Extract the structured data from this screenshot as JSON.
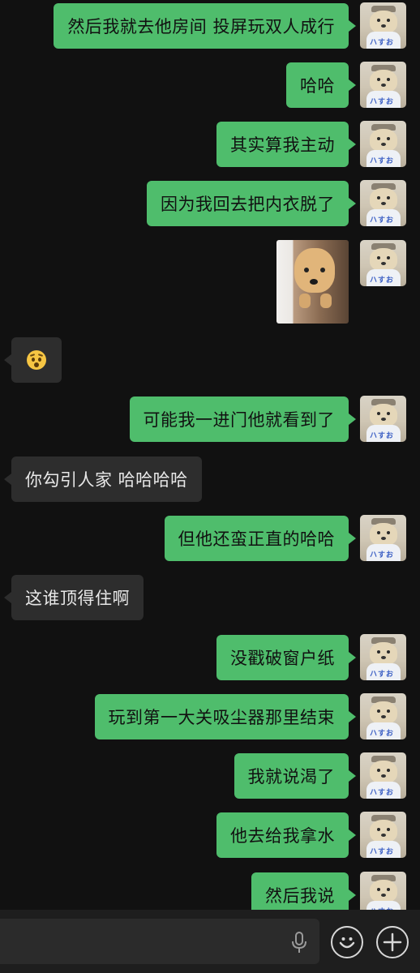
{
  "messages": [
    {
      "dir": "out",
      "type": "text",
      "text": "然后我就去他房间 投屏玩双人成行"
    },
    {
      "dir": "out",
      "type": "text",
      "text": "哈哈"
    },
    {
      "dir": "out",
      "type": "text",
      "text": "其实算我主动"
    },
    {
      "dir": "out",
      "type": "text",
      "text": "因为我回去把内衣脱了"
    },
    {
      "dir": "out",
      "type": "image",
      "description": "dog-photo"
    },
    {
      "dir": "in",
      "type": "emoji",
      "emoji": "😦"
    },
    {
      "dir": "out",
      "type": "text",
      "text": "可能我一进门他就看到了"
    },
    {
      "dir": "in",
      "type": "text",
      "text": "你勾引人家 哈哈哈哈"
    },
    {
      "dir": "out",
      "type": "text",
      "text": "但他还蛮正直的哈哈"
    },
    {
      "dir": "in",
      "type": "text",
      "text": "这谁顶得住啊"
    },
    {
      "dir": "out",
      "type": "text",
      "text": "没戳破窗户纸"
    },
    {
      "dir": "out",
      "type": "text",
      "text": "玩到第一大关吸尘器那里结束"
    },
    {
      "dir": "out",
      "type": "text",
      "text": "我就说渴了"
    },
    {
      "dir": "out",
      "type": "text",
      "text": "他去给我拿水"
    },
    {
      "dir": "out",
      "type": "text",
      "text": "然后我说"
    }
  ],
  "avatar": {
    "tag": "ハすお"
  },
  "input_bar": {
    "placeholder": "",
    "icons": [
      "microphone-icon",
      "emoji-icon",
      "plus-icon"
    ]
  },
  "colors": {
    "background": "#111111",
    "outgoing_bubble": "#4fbd6c",
    "incoming_bubble": "#2d2d2d",
    "input_bar": "#1e1e1e"
  }
}
